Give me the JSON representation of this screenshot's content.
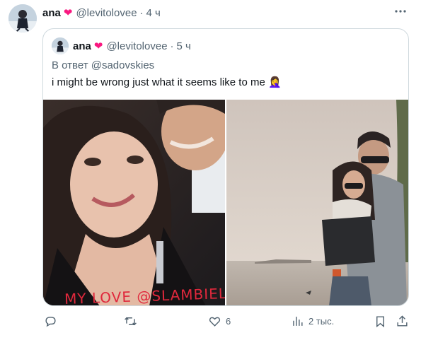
{
  "tweet": {
    "author_name": "ana",
    "author_handle": "@levitolovee",
    "separator": "·",
    "time": "4 ч"
  },
  "quoted": {
    "author_name": "ana",
    "author_handle": "@levitolovee",
    "separator": "·",
    "time": "5 ч",
    "reply_to": "В ответ @sadovskies",
    "text": "i might be wrong just what it seems like to me",
    "text_emoji": "🤦‍♀️",
    "photo_caption": "MY LOVE @SLAMBIEL"
  },
  "actions": {
    "reply_count": "",
    "retweet_count": "",
    "like_count": "6",
    "views_count": "2 тыс."
  },
  "colors": {
    "heart": "#f91880",
    "meta_text": "#536471",
    "border": "#cfd9de",
    "caption": "#e0283c"
  },
  "icons": [
    "heart-icon",
    "more-icon",
    "reply-icon",
    "retweet-icon",
    "like-icon",
    "views-icon",
    "bookmark-icon",
    "share-icon"
  ]
}
